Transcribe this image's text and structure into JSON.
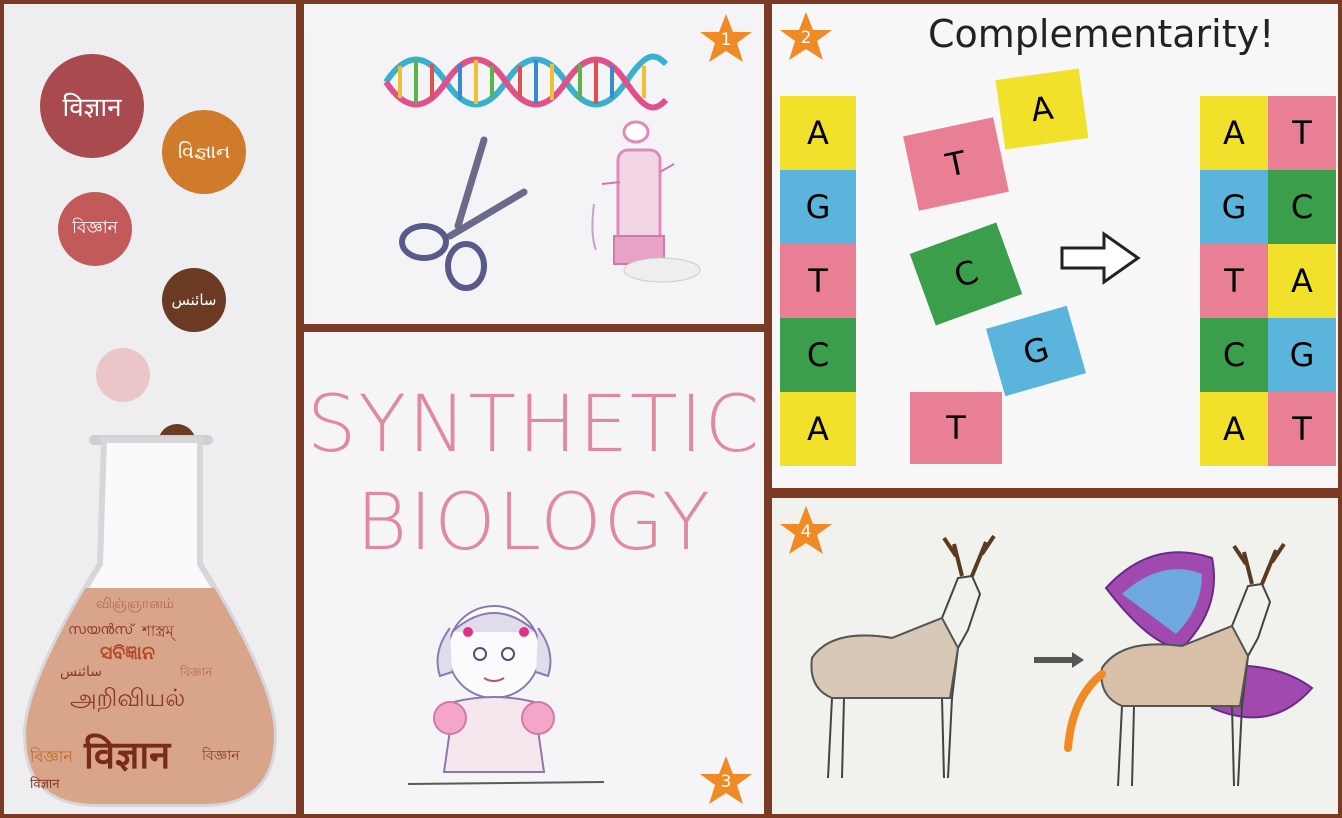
{
  "left_panel": {
    "bubbles": [
      {
        "text": "विज्ञान"
      },
      {
        "text": "વિજ્ઞાન"
      },
      {
        "text": "বিজ্ঞান"
      },
      {
        "text": "سائنس"
      }
    ],
    "flask_words": [
      "விஞ்ஞானம்",
      "শাস্ত্রম্",
      "സയൻസ്",
      "ସବିଜ୍ଞାନ",
      "سائنس",
      "அறிவியல்",
      "বিজ্ঞান",
      "विज्ञान",
      "বিজ্ঞান",
      "বিজ্ঞান",
      "विज्ञान"
    ],
    "colors": {
      "maroon": "#a94a4f",
      "orange": "#d07a2c",
      "rose": "#c25a5a",
      "brown": "#6b3a22",
      "pink": "#ebc6c9",
      "peach": "#e0a25a"
    }
  },
  "panel1": {
    "badge": "1"
  },
  "panel2": {
    "badge": "2",
    "title": "Complementarity!",
    "left_column": [
      "A",
      "G",
      "T",
      "C",
      "A"
    ],
    "loose_pieces": [
      "A",
      "T",
      "C",
      "G",
      "T"
    ],
    "pairs": [
      [
        "A",
        "T"
      ],
      [
        "G",
        "C"
      ],
      [
        "T",
        "A"
      ],
      [
        "C",
        "G"
      ],
      [
        "A",
        "T"
      ]
    ],
    "base_colors": {
      "A": "#f2e12a",
      "T": "#e97f94",
      "G": "#5ab4dc",
      "C": "#3a9e4a"
    }
  },
  "panel3": {
    "badge": "3",
    "line1": "SYNTHETIC",
    "line2": "BIOLOGY"
  },
  "panel4": {
    "badge": "4"
  },
  "accent": {
    "star": "#f08a24",
    "frame": "#7a3a24",
    "divider": "#d8b6ad"
  }
}
